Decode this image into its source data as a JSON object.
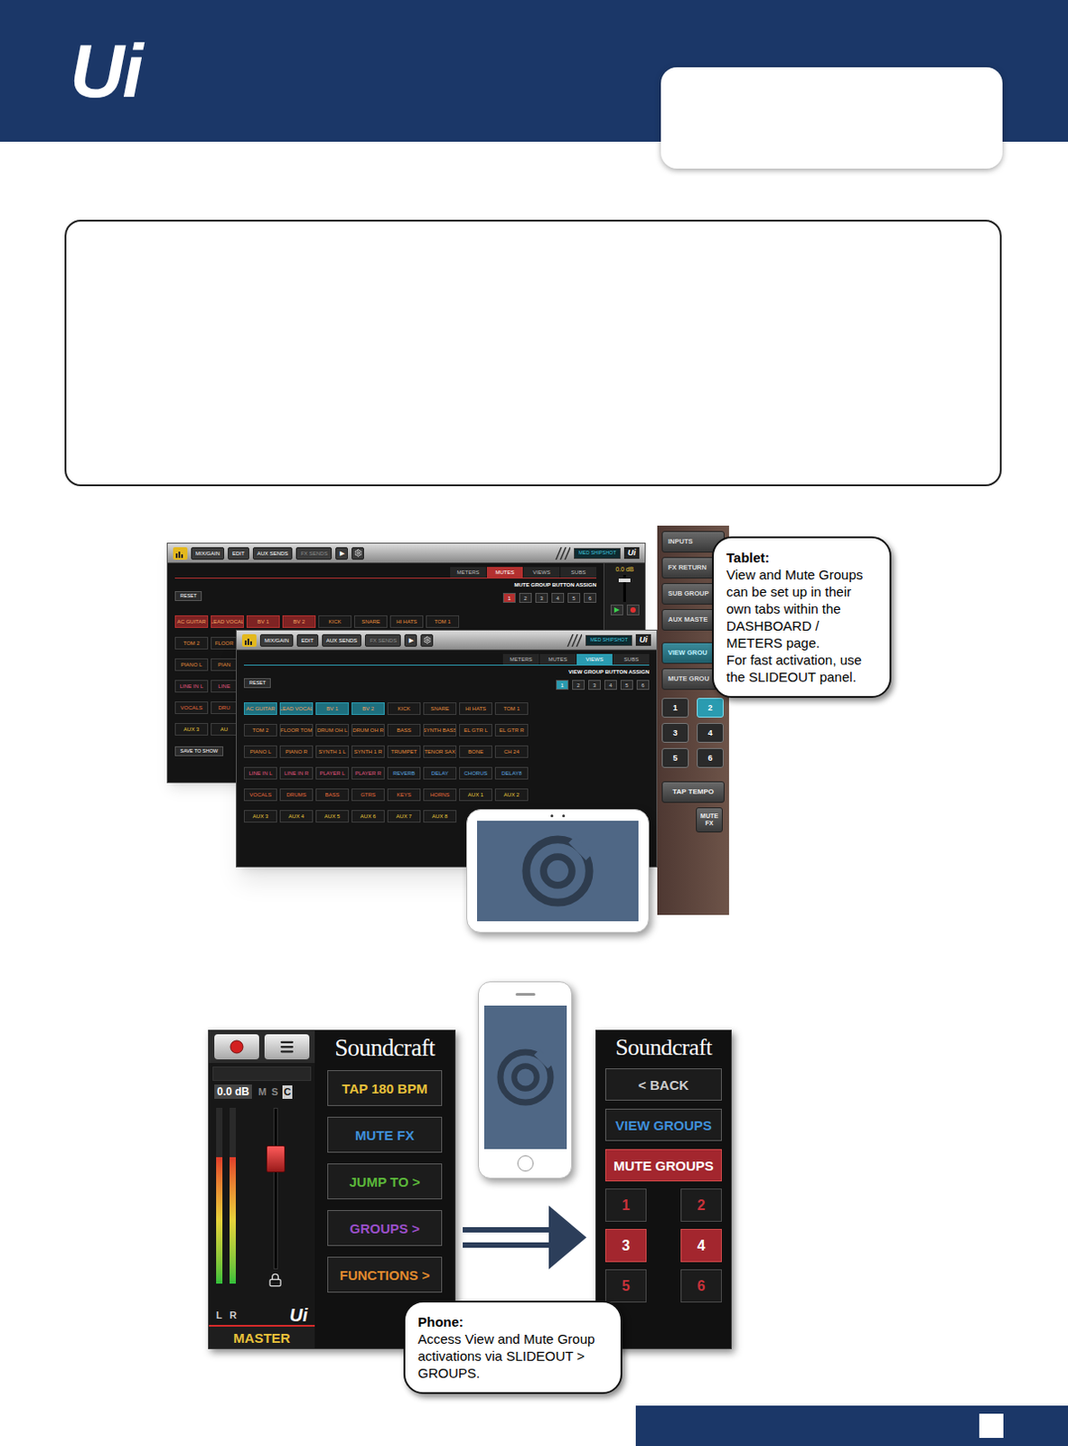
{
  "header": {
    "logo": "Ui"
  },
  "toolbar": {
    "buttons": [
      {
        "label": "MIX/GAIN",
        "disabled": false
      },
      {
        "label": "EDIT",
        "disabled": false
      },
      {
        "label": "AUX SENDS",
        "disabled": false
      },
      {
        "label": "FX SENDS",
        "disabled": true
      }
    ],
    "play": "▶",
    "snapshot": "MED SHIPSHOT",
    "logo": "Ui"
  },
  "mute_screen": {
    "tabs": [
      {
        "label": "METERS",
        "selected": false
      },
      {
        "label": "MUTES",
        "selected": true
      },
      {
        "label": "VIEWS",
        "selected": false
      },
      {
        "label": "SUBS",
        "selected": false
      }
    ],
    "assign_title": "MUTE GROUP BUTTON ASSIGN",
    "group_buttons": [
      {
        "label": "1",
        "selected": true
      },
      {
        "label": "2",
        "selected": false
      },
      {
        "label": "3",
        "selected": false
      },
      {
        "label": "4",
        "selected": false
      },
      {
        "label": "5",
        "selected": false
      },
      {
        "label": "6",
        "selected": false
      }
    ],
    "reset": "RESET",
    "save": "SAVE TO SHOW",
    "strip": {
      "reading": "0.0 dB",
      "level": 0.75
    },
    "rows": [
      [
        {
          "name": "AC GUITAR",
          "color": "#f0a060",
          "selected": true
        },
        {
          "name": "LEAD VOCAL",
          "color": "#f0a060",
          "selected": true
        },
        {
          "name": "BV 1",
          "color": "#f0a060",
          "selected": true
        },
        {
          "name": "BV 2",
          "color": "#f0a060",
          "selected": true
        },
        {
          "name": "KICK",
          "color": "#e38b3c",
          "selected": false
        },
        {
          "name": "SNARE",
          "color": "#e38b3c",
          "selected": false
        },
        {
          "name": "HI HATS",
          "color": "#e38b3c",
          "selected": false
        },
        {
          "name": "TOM 1",
          "color": "#e38b3c",
          "selected": false
        }
      ],
      [
        {
          "name": "TOM 2",
          "color": "#e38b3c",
          "selected": false
        },
        {
          "name": "FLOOR",
          "color": "#e38b3c",
          "selected": false
        }
      ],
      [
        {
          "name": "PIANO L",
          "color": "#e38b3c",
          "selected": false
        },
        {
          "name": "PIAN",
          "color": "#e38b3c",
          "selected": false
        }
      ],
      [
        {
          "name": "LINE IN L",
          "color": "#e0567f",
          "selected": false
        },
        {
          "name": "LINE",
          "color": "#e0567f",
          "selected": false
        }
      ],
      [
        {
          "name": "VOCALS",
          "color": "#e86b3a",
          "selected": false
        },
        {
          "name": "DRU",
          "color": "#e86b3a",
          "selected": false
        }
      ],
      [
        {
          "name": "AUX 3",
          "color": "#e5c53b",
          "selected": false
        },
        {
          "name": "AU",
          "color": "#e5c53b",
          "selected": false
        }
      ]
    ]
  },
  "view_screen": {
    "tabs": [
      {
        "label": "METERS",
        "selected": false
      },
      {
        "label": "MUTES",
        "selected": false
      },
      {
        "label": "VIEWS",
        "selected": true
      },
      {
        "label": "SUBS",
        "selected": false
      }
    ],
    "assign_title": "VIEW GROUP BUTTON ASSIGN",
    "group_buttons": [
      {
        "label": "1",
        "selected": true
      },
      {
        "label": "2",
        "selected": false
      },
      {
        "label": "3",
        "selected": false
      },
      {
        "label": "4",
        "selected": false
      },
      {
        "label": "5",
        "selected": false
      },
      {
        "label": "6",
        "selected": false
      }
    ],
    "reset": "RESET",
    "rows": [
      [
        {
          "name": "AC GUITAR",
          "color": "#f0a060",
          "selected": true
        },
        {
          "name": "LEAD VOCAL",
          "color": "#f0a060",
          "selected": true
        },
        {
          "name": "BV 1",
          "color": "#f0a060",
          "selected": true
        },
        {
          "name": "BV 2",
          "color": "#f0a060",
          "selected": true
        },
        {
          "name": "KICK",
          "color": "#e38b3c",
          "selected": false
        },
        {
          "name": "SNARE",
          "color": "#e38b3c",
          "selected": false
        },
        {
          "name": "HI HATS",
          "color": "#e38b3c",
          "selected": false
        },
        {
          "name": "TOM 1",
          "color": "#e38b3c",
          "selected": false
        }
      ],
      [
        {
          "name": "TOM 2",
          "color": "#e38b3c",
          "selected": false
        },
        {
          "name": "FLOOR TOM",
          "color": "#e38b3c",
          "selected": false
        },
        {
          "name": "DRUM OH L",
          "color": "#e38b3c",
          "selected": false
        },
        {
          "name": "DRUM OH R",
          "color": "#e38b3c",
          "selected": false
        },
        {
          "name": "BASS",
          "color": "#e38b3c",
          "selected": false
        },
        {
          "name": "SYNTH BASS",
          "color": "#e38b3c",
          "selected": false
        },
        {
          "name": "EL GTR L",
          "color": "#e38b3c",
          "selected": false
        },
        {
          "name": "EL GTR R",
          "color": "#e38b3c",
          "selected": false
        }
      ],
      [
        {
          "name": "PIANO L",
          "color": "#e38b3c",
          "selected": false
        },
        {
          "name": "PIANO R",
          "color": "#e38b3c",
          "selected": false
        },
        {
          "name": "SYNTH 1 L",
          "color": "#e38b3c",
          "selected": false
        },
        {
          "name": "SYNTH 1 R",
          "color": "#e38b3c",
          "selected": false
        },
        {
          "name": "TRUMPET",
          "color": "#e38b3c",
          "selected": false
        },
        {
          "name": "TENOR SAX",
          "color": "#e38b3c",
          "selected": false
        },
        {
          "name": "BONE",
          "color": "#e38b3c",
          "selected": false
        },
        {
          "name": "CH 24",
          "color": "#e38b3c",
          "selected": false
        }
      ],
      [
        {
          "name": "LINE IN L",
          "color": "#e0567f",
          "selected": false
        },
        {
          "name": "LINE IN R",
          "color": "#e0567f",
          "selected": false
        },
        {
          "name": "PLAYER L",
          "color": "#e0567f",
          "selected": false
        },
        {
          "name": "PLAYER R",
          "color": "#e0567f",
          "selected": false
        },
        {
          "name": "REVERB",
          "color": "#5aa7e0",
          "selected": false
        },
        {
          "name": "DELAY",
          "color": "#5aa7e0",
          "selected": false
        },
        {
          "name": "CHORUS",
          "color": "#5aa7e0",
          "selected": false
        },
        {
          "name": "DELAY8",
          "color": "#5aa7e0",
          "selected": false
        }
      ],
      [
        {
          "name": "VOCALS",
          "color": "#e86b3a",
          "selected": false
        },
        {
          "name": "DRUMS",
          "color": "#e86b3a",
          "selected": false
        },
        {
          "name": "BASS",
          "color": "#e86b3a",
          "selected": false
        },
        {
          "name": "GTRS",
          "color": "#e86b3a",
          "selected": false
        },
        {
          "name": "KEYS",
          "color": "#e86b3a",
          "selected": false
        },
        {
          "name": "HORNS",
          "color": "#e86b3a",
          "selected": false
        },
        {
          "name": "AUX 1",
          "color": "#e5c53b",
          "selected": false
        },
        {
          "name": "AUX 2",
          "color": "#e5c53b",
          "selected": false
        }
      ],
      [
        {
          "name": "AUX 3",
          "color": "#e5c53b",
          "selected": false
        },
        {
          "name": "AUX 4",
          "color": "#e5c53b",
          "selected": false
        },
        {
          "name": "AUX 5",
          "color": "#e5c53b",
          "selected": false
        },
        {
          "name": "AUX 6",
          "color": "#e5c53b",
          "selected": false
        },
        {
          "name": "AUX 7",
          "color": "#e5c53b",
          "selected": false
        },
        {
          "name": "AUX 8",
          "color": "#e5c53b",
          "selected": false
        }
      ]
    ]
  },
  "slideout": {
    "sections": [
      {
        "label": "INPUTS",
        "selected": false
      },
      {
        "label": "FX RETURN",
        "selected": false
      },
      {
        "label": "SUB GROUP",
        "selected": false
      },
      {
        "label": "AUX MASTE",
        "selected": false
      }
    ],
    "group_tabs": [
      {
        "label": "VIEW GROU",
        "selected": true
      },
      {
        "label": "MUTE GROU",
        "selected": false
      }
    ],
    "groups": [
      {
        "label": "1",
        "selected": false
      },
      {
        "label": "2",
        "selected": true
      },
      {
        "label": "3",
        "selected": false
      },
      {
        "label": "4",
        "selected": false
      },
      {
        "label": "5",
        "selected": false
      },
      {
        "label": "6",
        "selected": false
      }
    ],
    "tap": "TAP TEMPO",
    "mute_fx": "MUTE FX"
  },
  "tablet_callout": {
    "title": "Tablet:",
    "body": [
      "View and Mute Groups can be set up in their own tabs within the DASHBOARD / METERS page.",
      "For fast activation, use the SLIDEOUT panel."
    ]
  },
  "phone_main": {
    "reading": "0.0 dB",
    "msc": [
      {
        "label": "M",
        "selected": false
      },
      {
        "label": "S",
        "selected": false
      },
      {
        "label": "C",
        "selected": true
      }
    ],
    "meters": [
      {
        "label": "L",
        "level": 0.72
      },
      {
        "label": "R",
        "level": 0.72
      }
    ],
    "fader_level": 0.72,
    "logo": "Ui",
    "channel": "MASTER",
    "brand": "Soundcraft",
    "buttons": [
      {
        "label": "TAP 180 BPM",
        "color": "#e8c13a"
      },
      {
        "label": "MUTE FX",
        "color": "#3f8fd9"
      },
      {
        "label": "JUMP TO >",
        "color": "#5bb83a"
      },
      {
        "label": "GROUPS >",
        "color": "#9a4fc9"
      },
      {
        "label": "FUNCTIONS >",
        "color": "#e08a2e"
      }
    ]
  },
  "phone_groups": {
    "brand": "Soundcraft",
    "back": "< BACK",
    "tabs": [
      {
        "label": "VIEW GROUPS",
        "selected": false
      },
      {
        "label": "MUTE GROUPS",
        "selected": true
      }
    ],
    "groups": [
      {
        "label": "1",
        "selected": false
      },
      {
        "label": "2",
        "selected": false
      },
      {
        "label": "3",
        "selected": true
      },
      {
        "label": "4",
        "selected": true
      },
      {
        "label": "5",
        "selected": false
      },
      {
        "label": "6",
        "selected": false
      }
    ]
  },
  "phone_callout": {
    "title": "Phone:",
    "body": [
      "Access View and Mute Group activations via SLIDEOUT > GROUPS."
    ]
  }
}
